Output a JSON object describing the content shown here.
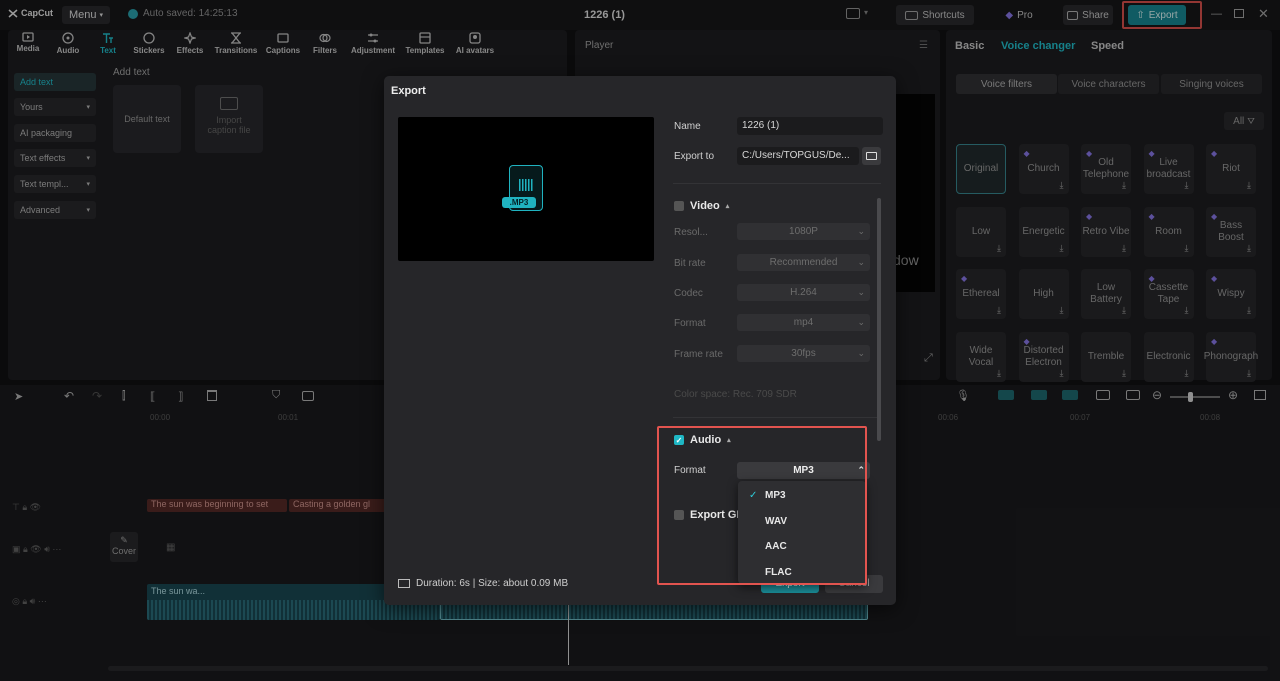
{
  "titlebar": {
    "logo": "CapCut",
    "menu": "Menu",
    "autosave": "Auto saved: 14:25:13",
    "project_title": "1226 (1)",
    "shortcuts": "Shortcuts",
    "pro": "Pro",
    "share": "Share",
    "export": "Export"
  },
  "toolbar": [
    "Media",
    "Audio",
    "Text",
    "Stickers",
    "Effects",
    "Transitions",
    "Captions",
    "Filters",
    "Adjustment",
    "Templates",
    "AI avatars"
  ],
  "left_panel": {
    "items": [
      "Add text",
      "Yours",
      "AI packaging",
      "Text effects",
      "Text templ...",
      "Advanced"
    ],
    "section_title": "Add text",
    "default_text": "Default text",
    "import_caption": "Import caption file"
  },
  "player": {
    "title": "Player",
    "overlay_text": "dow"
  },
  "right_panel": {
    "tabs": [
      "Basic",
      "Voice changer",
      "Speed"
    ],
    "subtabs": [
      "Voice filters",
      "Voice characters",
      "Singing voices"
    ],
    "filter_all": "All",
    "voices": [
      "Original",
      "Church",
      "Old Telephone",
      "Live broadcast",
      "Riot",
      "Low",
      "Energetic",
      "Retro Vibe",
      "Room",
      "Bass Boost",
      "Ethereal",
      "High",
      "Low Battery",
      "Cassette Tape",
      "Wispy",
      "Wide Vocal",
      "Distorted Electron",
      "Tremble",
      "Electronic",
      "Phonograph"
    ]
  },
  "timeline": {
    "times": [
      "00:00",
      "00:01",
      "00:06",
      "00:07",
      "00:08"
    ],
    "text_clips": [
      "The sun was beginning to set",
      "Casting a golden gl"
    ],
    "cover_label": "Cover",
    "audio_clip": "The sun wa..."
  },
  "export_dialog": {
    "title": "Export",
    "file_badge": ".MP3",
    "name_label": "Name",
    "name_value": "1226 (1)",
    "export_to_label": "Export to",
    "export_to_value": "C:/Users/TOPGUS/De...",
    "video_label": "Video",
    "resolution_label": "Resol...",
    "resolution_value": "1080P",
    "bitrate_label": "Bit rate",
    "bitrate_value": "Recommended",
    "codec_label": "Codec",
    "codec_value": "H.264",
    "format_label": "Format",
    "format_value": "mp4",
    "framerate_label": "Frame rate",
    "framerate_value": "30fps",
    "color_space": "Color space: Rec. 709 SDR",
    "audio_label": "Audio",
    "audio_format_label": "Format",
    "audio_format_value": "MP3",
    "export_gif_label": "Export GIF",
    "audio_formats": [
      "MP3",
      "WAV",
      "AAC",
      "FLAC"
    ],
    "selected_format": "MP3",
    "footer_info": "Duration: 6s | Size: about 0.09 MB",
    "export_button": "Export",
    "cancel_button": "Cancel"
  },
  "colors": {
    "accent": "#22c5d3",
    "highlight_border": "#e2544f",
    "panel": "#1e1e21"
  }
}
